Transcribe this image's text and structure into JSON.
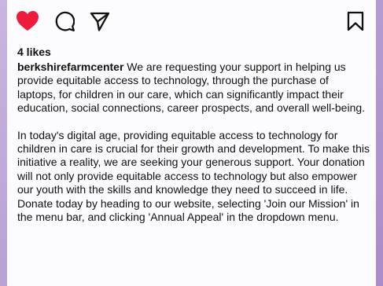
{
  "post": {
    "likes_text": "4 likes",
    "username": "berkshirefarmcenter",
    "caption_first": "We are requesting your support in helping us provide equitable access to technology, through the purchase of laptops, for children in our care, which can significantly impact their education, social connections, career prospects, and overall well-being.",
    "caption_second": "In today's digital age, providing equitable access to technology for children in care is crucial for their growth and development. To make this initiative a reality, we are seeking your generous support. Your donation will not only provide equitable access to technology but also empower our youth with the skills and knowledge they need to succeed in life. Donate today by heading to our website, selecting 'Join our Mission' in the menu bar, and clicking 'Annual Appeal' in the dropdown menu."
  },
  "icons": {
    "like": "heart-icon",
    "comment": "comment-icon",
    "share": "share-icon",
    "save": "bookmark-icon"
  },
  "colors": {
    "like_active": "#ed1c3c"
  }
}
